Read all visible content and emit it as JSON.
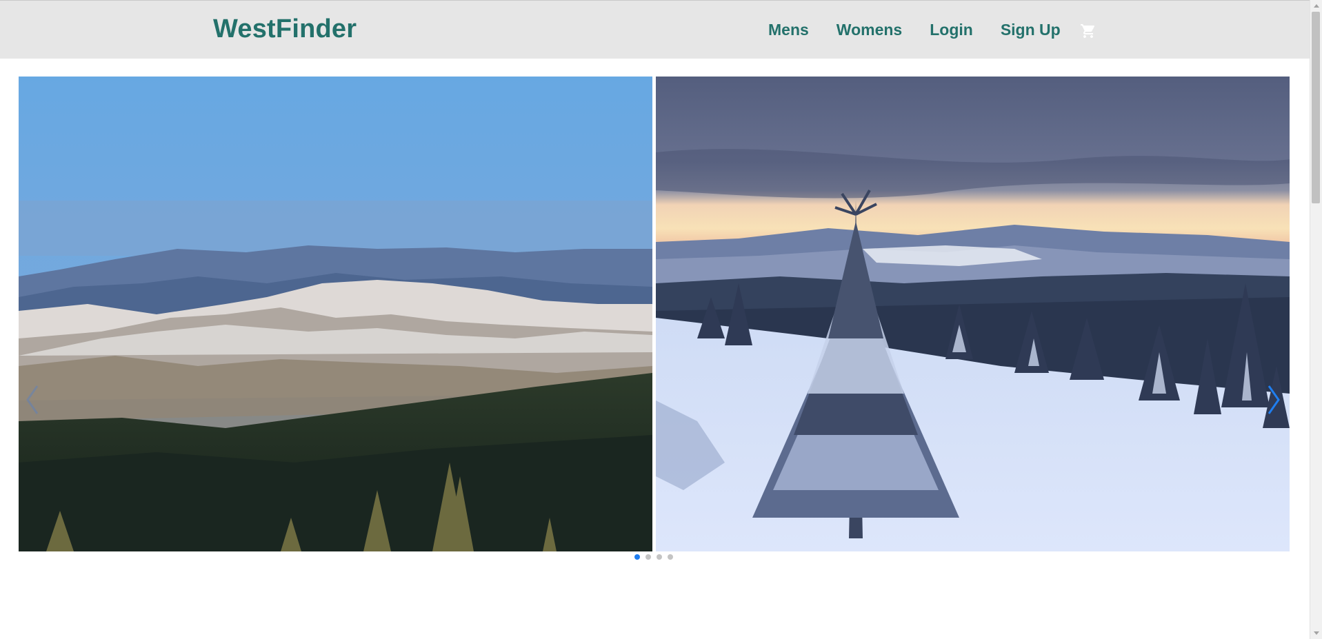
{
  "brand": {
    "name": "WestFinder"
  },
  "nav": {
    "items": [
      {
        "label": "Mens"
      },
      {
        "label": "Womens"
      },
      {
        "label": "Login"
      },
      {
        "label": "Sign Up"
      }
    ],
    "cart_icon": "shopping-cart-icon"
  },
  "carousel": {
    "slides": [
      {
        "scene": "snowy-mountain-ridges-under-blue-sky"
      },
      {
        "scene": "frosted-spruce-trees-at-sunset"
      }
    ],
    "active_index": 0,
    "slide_count": 4,
    "prev_icon": "chevron-left-icon",
    "next_icon": "chevron-right-icon"
  },
  "colors": {
    "brand": "#23716b",
    "header_bg": "#e6e6e6",
    "accent": "#1f7ef0",
    "dot_inactive": "#c4c4c4"
  }
}
